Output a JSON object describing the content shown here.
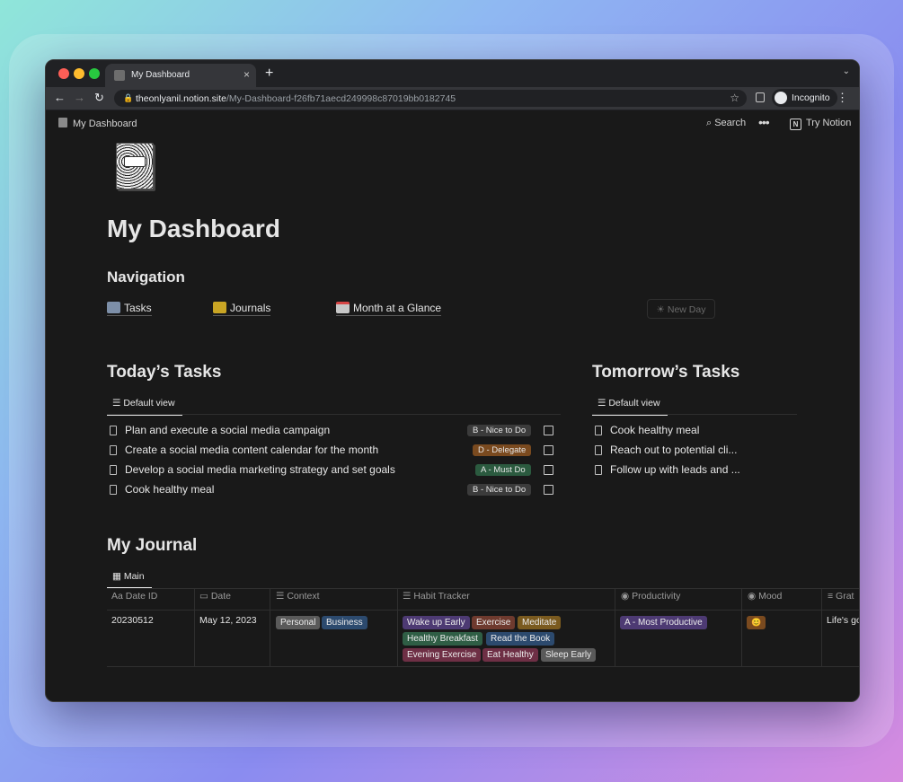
{
  "browser": {
    "tab_title": "My Dashboard",
    "tab_close": "×",
    "new_tab": "+",
    "tab_menu": "⌄",
    "url_host": "theonlyanil.notion.site",
    "url_path": "/My-Dashboard-f26fb71aecd249998c87019bb0182745",
    "profile_label": "Incognito",
    "icons": [
      "back-icon",
      "forward-icon",
      "reload-icon",
      "lock-icon",
      "star-icon",
      "side-panel-icon",
      "kebab-icon"
    ]
  },
  "topbar": {
    "breadcrumb": "My Dashboard",
    "search_label": "Search",
    "more_label": "•••",
    "try_label": "Try Notion"
  },
  "page": {
    "title": "My Dashboard",
    "navigation_heading": "Navigation",
    "nav_links": [
      "Tasks",
      "Journals",
      "Month at a Glance"
    ],
    "new_day_button": "New Day"
  },
  "today": {
    "heading": "Today’s Tasks",
    "view_label": "Default view",
    "tasks": [
      {
        "title": "Plan and execute a social media campaign",
        "priority": "B - Nice to Do",
        "color": "#3b3b3b"
      },
      {
        "title": "Create a social media content calendar for the month",
        "priority": "D - Delegate",
        "color": "#7a4a1f"
      },
      {
        "title": "Develop a social media marketing strategy and set goals",
        "priority": "A - Must Do",
        "color": "#2b5a3f"
      },
      {
        "title": "Cook healthy meal",
        "priority": "B - Nice to Do",
        "color": "#3b3b3b"
      }
    ]
  },
  "tomorrow": {
    "heading": "Tomorrow’s Tasks",
    "view_label": "Default view",
    "tasks": [
      "Cook healthy meal",
      "Reach out to potential cli...",
      "Follow up with leads and ..."
    ]
  },
  "journal": {
    "heading": "My Journal",
    "view_label": "Main",
    "columns": [
      {
        "icon": "Aa",
        "label": "Date ID"
      },
      {
        "icon": "calendar",
        "label": "Date"
      },
      {
        "icon": "list",
        "label": "Context"
      },
      {
        "icon": "list",
        "label": "Habit Tracker"
      },
      {
        "icon": "status",
        "label": "Productivity"
      },
      {
        "icon": "status",
        "label": "Mood"
      },
      {
        "icon": "text",
        "label": "Grat"
      }
    ],
    "row": {
      "date_id": "20230512",
      "date": "May 12, 2023",
      "context": [
        {
          "label": "Personal",
          "color": "#5a5a5a"
        },
        {
          "label": "Business",
          "color": "#2c4a6e"
        }
      ],
      "habits": [
        {
          "label": "Wake up Early",
          "color": "#4d3a73"
        },
        {
          "label": "Exercise",
          "color": "#6e3a2e"
        },
        {
          "label": "Meditate",
          "color": "#7a5a1f"
        },
        {
          "label": "Healthy Breakfast",
          "color": "#2f5e45"
        },
        {
          "label": "Read the Book",
          "color": "#2c4a6e"
        },
        {
          "label": "Evening Exercise",
          "color": "#6e2f45"
        },
        {
          "label": "Eat Healthy",
          "color": "#6e2f45"
        },
        {
          "label": "Sleep Early",
          "color": "#5a5a5a"
        }
      ],
      "productivity": "A - Most Productive",
      "mood": "😊",
      "gratitude": "Life's go"
    }
  }
}
